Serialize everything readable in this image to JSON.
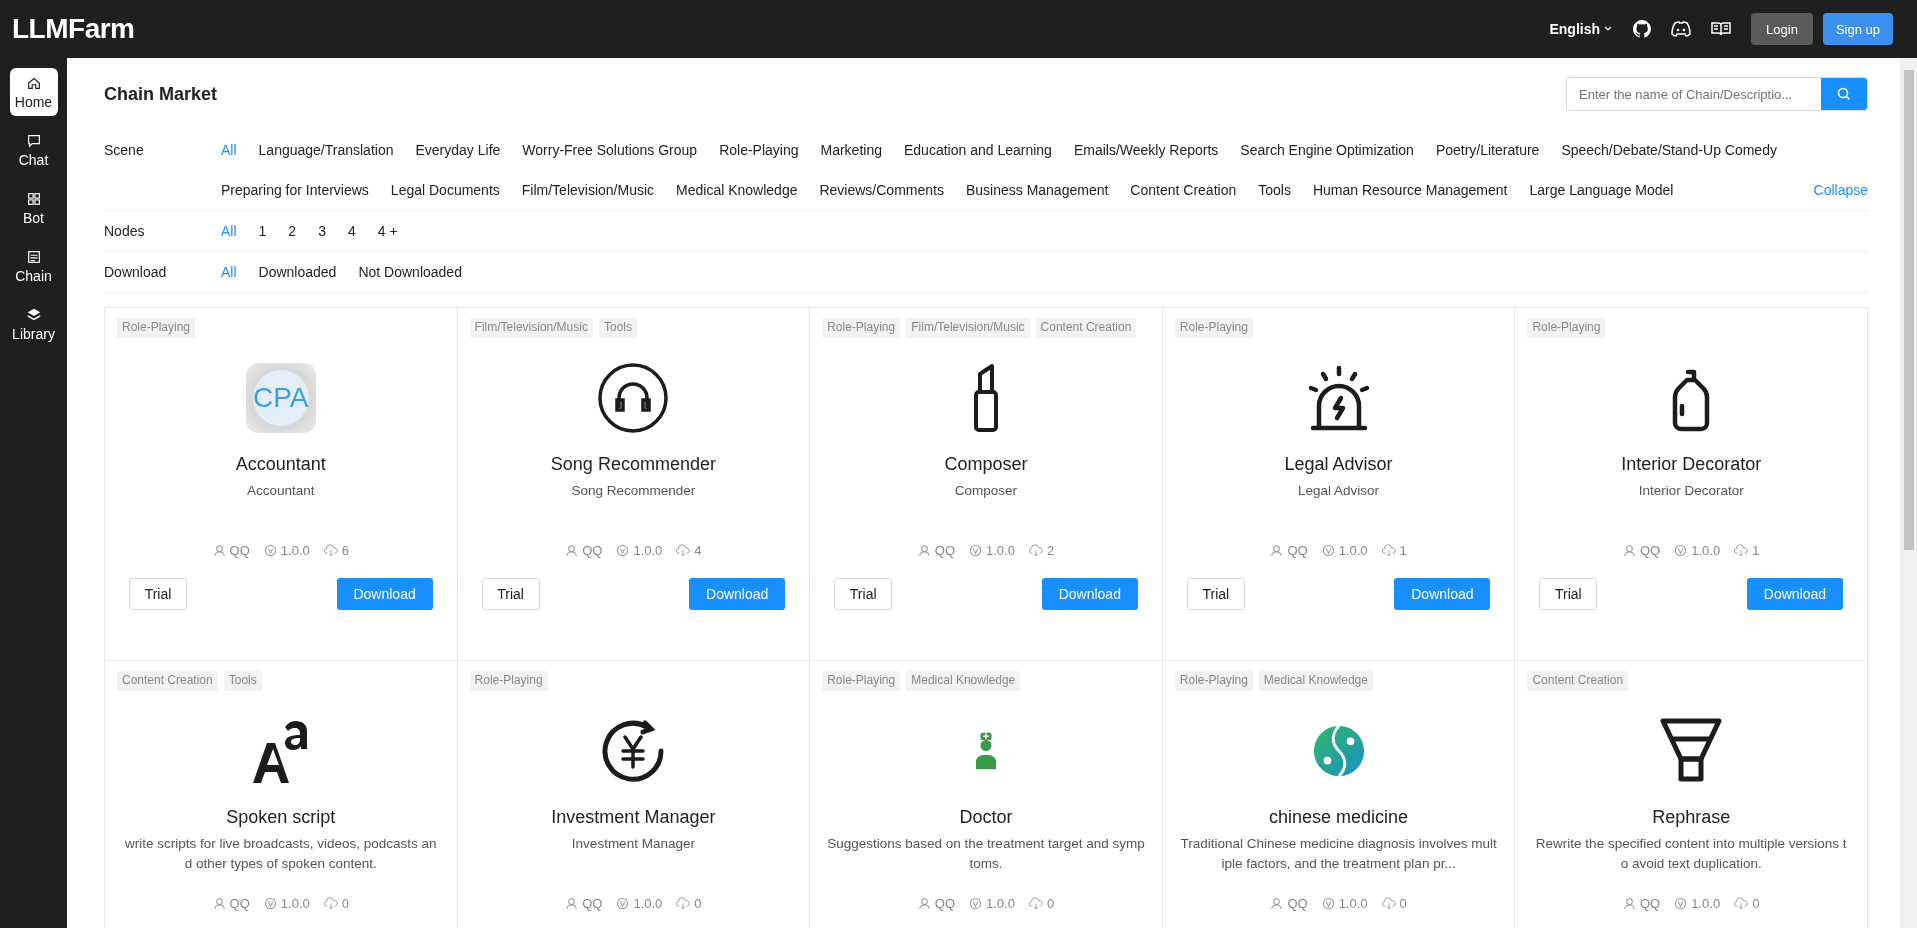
{
  "header": {
    "logo": "LLMFarm",
    "language": "English",
    "login": "Login",
    "signup": "Sign up"
  },
  "sidebar": {
    "items": [
      {
        "label": "Home",
        "selected": true
      },
      {
        "label": "Chat",
        "selected": false
      },
      {
        "label": "Bot",
        "selected": false
      },
      {
        "label": "Chain",
        "selected": false
      },
      {
        "label": "Library",
        "selected": false
      }
    ]
  },
  "page": {
    "title": "Chain Market",
    "search": {
      "placeholder": "Enter the name of Chain/Descriptio..."
    }
  },
  "filters": [
    {
      "label": "Scene",
      "collapse": "Collapse",
      "options": [
        {
          "label": "All",
          "selected": true
        },
        {
          "label": "Language/Translation",
          "selected": false
        },
        {
          "label": "Everyday Life",
          "selected": false
        },
        {
          "label": "Worry-Free Solutions Group",
          "selected": false
        },
        {
          "label": "Role-Playing",
          "selected": false
        },
        {
          "label": "Marketing",
          "selected": false
        },
        {
          "label": "Education and Learning",
          "selected": false
        },
        {
          "label": "Emails/Weekly Reports",
          "selected": false
        },
        {
          "label": "Search Engine Optimization",
          "selected": false
        },
        {
          "label": "Poetry/Literature",
          "selected": false
        },
        {
          "label": "Speech/Debate/Stand-Up Comedy",
          "selected": false
        },
        {
          "label": "Preparing for Interviews",
          "selected": false
        },
        {
          "label": "Legal Documents",
          "selected": false
        },
        {
          "label": "Film/Television/Music",
          "selected": false
        },
        {
          "label": "Medical Knowledge",
          "selected": false
        },
        {
          "label": "Reviews/Comments",
          "selected": false
        },
        {
          "label": "Business Management",
          "selected": false
        },
        {
          "label": "Content Creation",
          "selected": false
        },
        {
          "label": "Tools",
          "selected": false
        },
        {
          "label": "Human Resource Management",
          "selected": false
        },
        {
          "label": "Large Language Model",
          "selected": false
        }
      ]
    },
    {
      "label": "Nodes",
      "options": [
        {
          "label": "All",
          "selected": true
        },
        {
          "label": "1",
          "selected": false
        },
        {
          "label": "2",
          "selected": false
        },
        {
          "label": "3",
          "selected": false
        },
        {
          "label": "4",
          "selected": false
        },
        {
          "label": "4 +",
          "selected": false
        }
      ]
    },
    {
      "label": "Download",
      "options": [
        {
          "label": "All",
          "selected": true
        },
        {
          "label": "Downloaded",
          "selected": false
        },
        {
          "label": "Not Downloaded",
          "selected": false
        }
      ]
    }
  ],
  "cards": [
    {
      "tags": [
        "Role-Playing"
      ],
      "icon_text": "CPA",
      "title": "Accountant",
      "description": "Accountant",
      "author": "QQ",
      "version": "1.0.0",
      "downloads": "6",
      "trial": "Trial",
      "download": "Download"
    },
    {
      "tags": [
        "Film/Television/Music",
        "Tools"
      ],
      "title": "Song Recommender",
      "description": "Song Recommender",
      "author": "QQ",
      "version": "1.0.0",
      "downloads": "4",
      "trial": "Trial",
      "download": "Download"
    },
    {
      "tags": [
        "Role-Playing",
        "Film/Television/Music",
        "Content Creation"
      ],
      "title": "Composer",
      "description": "Composer",
      "author": "QQ",
      "version": "1.0.0",
      "downloads": "2",
      "trial": "Trial",
      "download": "Download"
    },
    {
      "tags": [
        "Role-Playing"
      ],
      "title": "Legal Advisor",
      "description": "Legal Advisor",
      "author": "QQ",
      "version": "1.0.0",
      "downloads": "1",
      "trial": "Trial",
      "download": "Download"
    },
    {
      "tags": [
        "Role-Playing"
      ],
      "title": "Interior Decorator",
      "description": "Interior Decorator",
      "author": "QQ",
      "version": "1.0.0",
      "downloads": "1",
      "trial": "Trial",
      "download": "Download"
    },
    {
      "tags": [
        "Content Creation",
        "Tools"
      ],
      "title": "Spoken script",
      "description": "write scripts for live broadcasts, videos, podcasts and other types of spoken content.",
      "author": "QQ",
      "version": "1.0.0",
      "downloads": "0"
    },
    {
      "tags": [
        "Role-Playing"
      ],
      "title": "Investment Manager",
      "description": "Investment Manager",
      "author": "QQ",
      "version": "1.0.0",
      "downloads": "0"
    },
    {
      "tags": [
        "Role-Playing",
        "Medical Knowledge"
      ],
      "title": "Doctor",
      "description": "Suggestions based on the treatment target and symptoms.",
      "author": "QQ",
      "version": "1.0.0",
      "downloads": "0"
    },
    {
      "tags": [
        "Role-Playing",
        "Medical Knowledge"
      ],
      "title": "chinese medicine",
      "description": "Traditional Chinese medicine diagnosis involves multiple factors, and the treatment plan pr...",
      "author": "QQ",
      "version": "1.0.0",
      "downloads": "0"
    },
    {
      "tags": [
        "Content Creation"
      ],
      "title": "Rephrase",
      "description": "Rewrite the specified content into multiple versions to avoid text duplication.",
      "author": "QQ",
      "version": "1.0.0",
      "downloads": "0"
    }
  ]
}
